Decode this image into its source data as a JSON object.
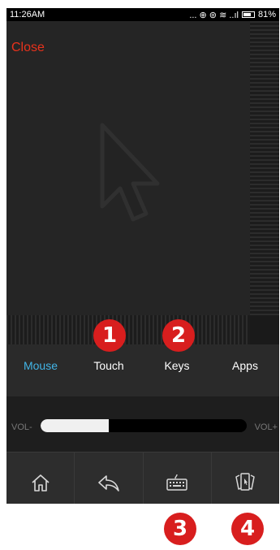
{
  "status_bar": {
    "time": "11:26AM",
    "icons": "... ⊕ ⊚ ≋ ..ıl",
    "battery": "81%",
    "battery_level": 0.81
  },
  "touchpad": {
    "close_label": "Close",
    "cursor_icon": "arrow-cursor-icon"
  },
  "tabs": [
    {
      "label": "Mouse",
      "active": true
    },
    {
      "label": "Touch",
      "active": false
    },
    {
      "label": "Keys",
      "active": false
    },
    {
      "label": "Apps",
      "active": false
    }
  ],
  "volume": {
    "minus_label": "VOL-",
    "plus_label": "VOL+",
    "level": 0.33
  },
  "navbar": {
    "icons": [
      "home-icon",
      "back-icon",
      "keyboard-icon",
      "app-switcher-icon"
    ]
  },
  "badges": [
    "1",
    "2",
    "3",
    "4"
  ],
  "colors": {
    "accent": "#42b4e6",
    "close": "#e8321c",
    "badge": "#d81e1e"
  }
}
